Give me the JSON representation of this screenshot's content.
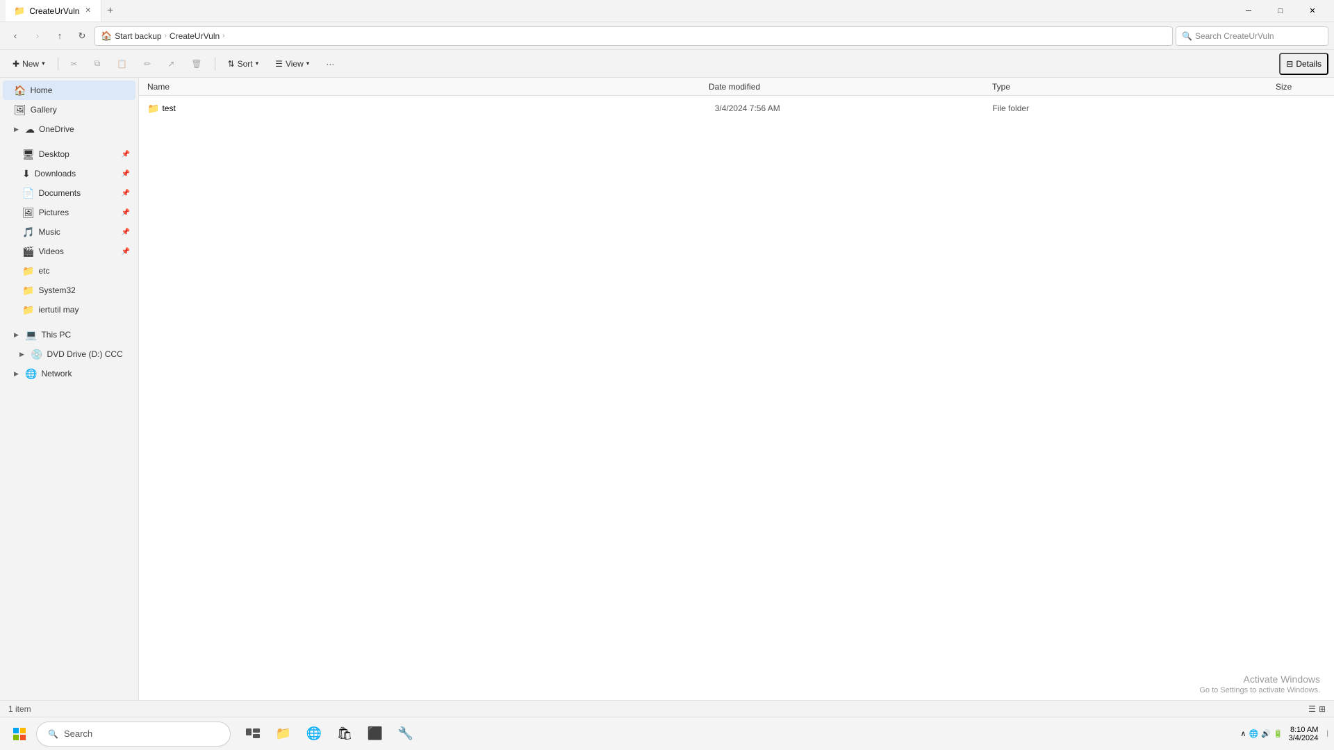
{
  "window": {
    "title": "CreateUrVuln",
    "tab_label": "CreateUrVuln"
  },
  "address": {
    "back_disabled": false,
    "forward_disabled": true,
    "up_disabled": false,
    "refresh_label": "↻",
    "breadcrumbs": [
      {
        "label": "Start backup",
        "icon": "🏠"
      },
      {
        "label": "CreateUrVuln"
      }
    ],
    "search_placeholder": "Search CreateUrVuln"
  },
  "toolbar": {
    "new_label": "New",
    "cut_label": "✂",
    "copy_label": "⧉",
    "paste_label": "📋",
    "rename_label": "✏",
    "share_label": "↗",
    "delete_label": "🗑",
    "sort_label": "Sort",
    "view_label": "View",
    "more_label": "···",
    "details_label": "Details"
  },
  "sidebar": {
    "items": [
      {
        "id": "home",
        "label": "Home",
        "icon": "🏠",
        "active": true,
        "indent": 0,
        "expandable": false,
        "pinned": false
      },
      {
        "id": "gallery",
        "label": "Gallery",
        "icon": "🖼",
        "active": false,
        "indent": 0,
        "expandable": false,
        "pinned": false
      },
      {
        "id": "onedrive",
        "label": "OneDrive",
        "icon": "☁",
        "active": false,
        "indent": 0,
        "expandable": true,
        "pinned": false
      },
      {
        "id": "desktop",
        "label": "Desktop",
        "icon": "🖥",
        "active": false,
        "indent": 1,
        "expandable": false,
        "pinned": true
      },
      {
        "id": "downloads",
        "label": "Downloads",
        "icon": "⬇",
        "active": false,
        "indent": 1,
        "expandable": false,
        "pinned": true
      },
      {
        "id": "documents",
        "label": "Documents",
        "icon": "📄",
        "active": false,
        "indent": 1,
        "expandable": false,
        "pinned": true
      },
      {
        "id": "pictures",
        "label": "Pictures",
        "icon": "🖼",
        "active": false,
        "indent": 1,
        "expandable": false,
        "pinned": true
      },
      {
        "id": "music",
        "label": "Music",
        "icon": "🎵",
        "active": false,
        "indent": 1,
        "expandable": false,
        "pinned": true
      },
      {
        "id": "videos",
        "label": "Videos",
        "icon": "🎬",
        "active": false,
        "indent": 1,
        "expandable": false,
        "pinned": true
      },
      {
        "id": "etc",
        "label": "etc",
        "icon": "📁",
        "active": false,
        "indent": 1,
        "expandable": false,
        "pinned": false
      },
      {
        "id": "system32",
        "label": "System32",
        "icon": "📁",
        "active": false,
        "indent": 1,
        "expandable": false,
        "pinned": false
      },
      {
        "id": "iert",
        "label": "iertutil may",
        "icon": "📁",
        "active": false,
        "indent": 1,
        "expandable": false,
        "pinned": false
      },
      {
        "id": "thispc",
        "label": "This PC",
        "icon": "💻",
        "active": false,
        "indent": 0,
        "expandable": true,
        "pinned": false
      },
      {
        "id": "dvddrive",
        "label": "DVD Drive (D:) CCC",
        "icon": "💿",
        "active": false,
        "indent": 1,
        "expandable": true,
        "pinned": false
      },
      {
        "id": "network",
        "label": "Network",
        "icon": "🌐",
        "active": false,
        "indent": 0,
        "expandable": true,
        "pinned": false
      }
    ]
  },
  "columns": {
    "name": "Name",
    "date_modified": "Date modified",
    "type": "Type",
    "size": "Size"
  },
  "files": [
    {
      "name": "test",
      "icon": "📁",
      "date_modified": "3/4/2024 7:56 AM",
      "type": "File folder",
      "size": ""
    }
  ],
  "status": {
    "item_count": "1 item"
  },
  "taskbar": {
    "search_placeholder": "Search",
    "time": "8:10 AM",
    "date": "3/4/2024"
  },
  "watermark": {
    "line1": "Activate Windows",
    "line2": "Go to Settings to activate Windows."
  }
}
